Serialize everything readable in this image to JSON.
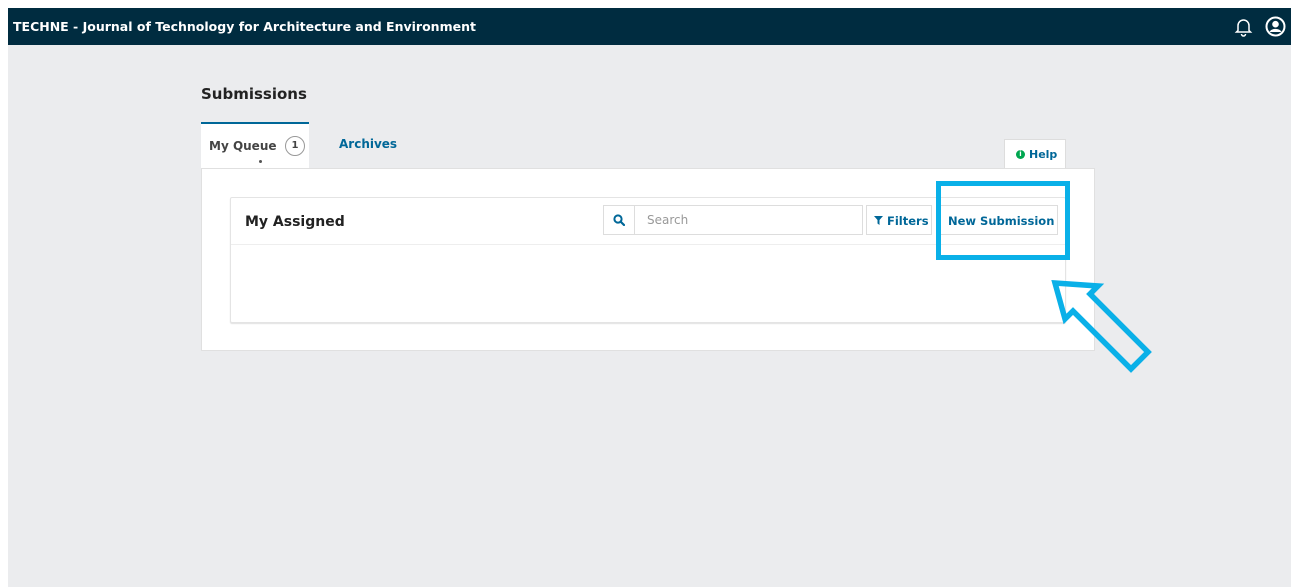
{
  "header": {
    "title": "TECHNE - Journal of Technology for Architecture and Environment",
    "background_color": "#002c40",
    "icons": [
      "bell-icon",
      "user-circle-icon"
    ]
  },
  "page": {
    "title": "Submissions"
  },
  "tabs": {
    "my_queue": {
      "label": "My Queue",
      "count": "1"
    },
    "archives": {
      "label": "Archives"
    }
  },
  "help": {
    "label": "Help",
    "icon": "info-circle-icon"
  },
  "list": {
    "title": "My Assigned",
    "search": {
      "placeholder": "Search",
      "value": ""
    },
    "filters_label": "Filters",
    "new_submission_label": "New Submission"
  },
  "annotation": {
    "color": "#0ab0e8",
    "highlight_target": "new-submission-button",
    "arrow_icon": "arrow-up-left-outline-icon"
  },
  "colors": {
    "accent": "#006798",
    "page_background": "#ebecee",
    "help_icon": "#00a650"
  }
}
